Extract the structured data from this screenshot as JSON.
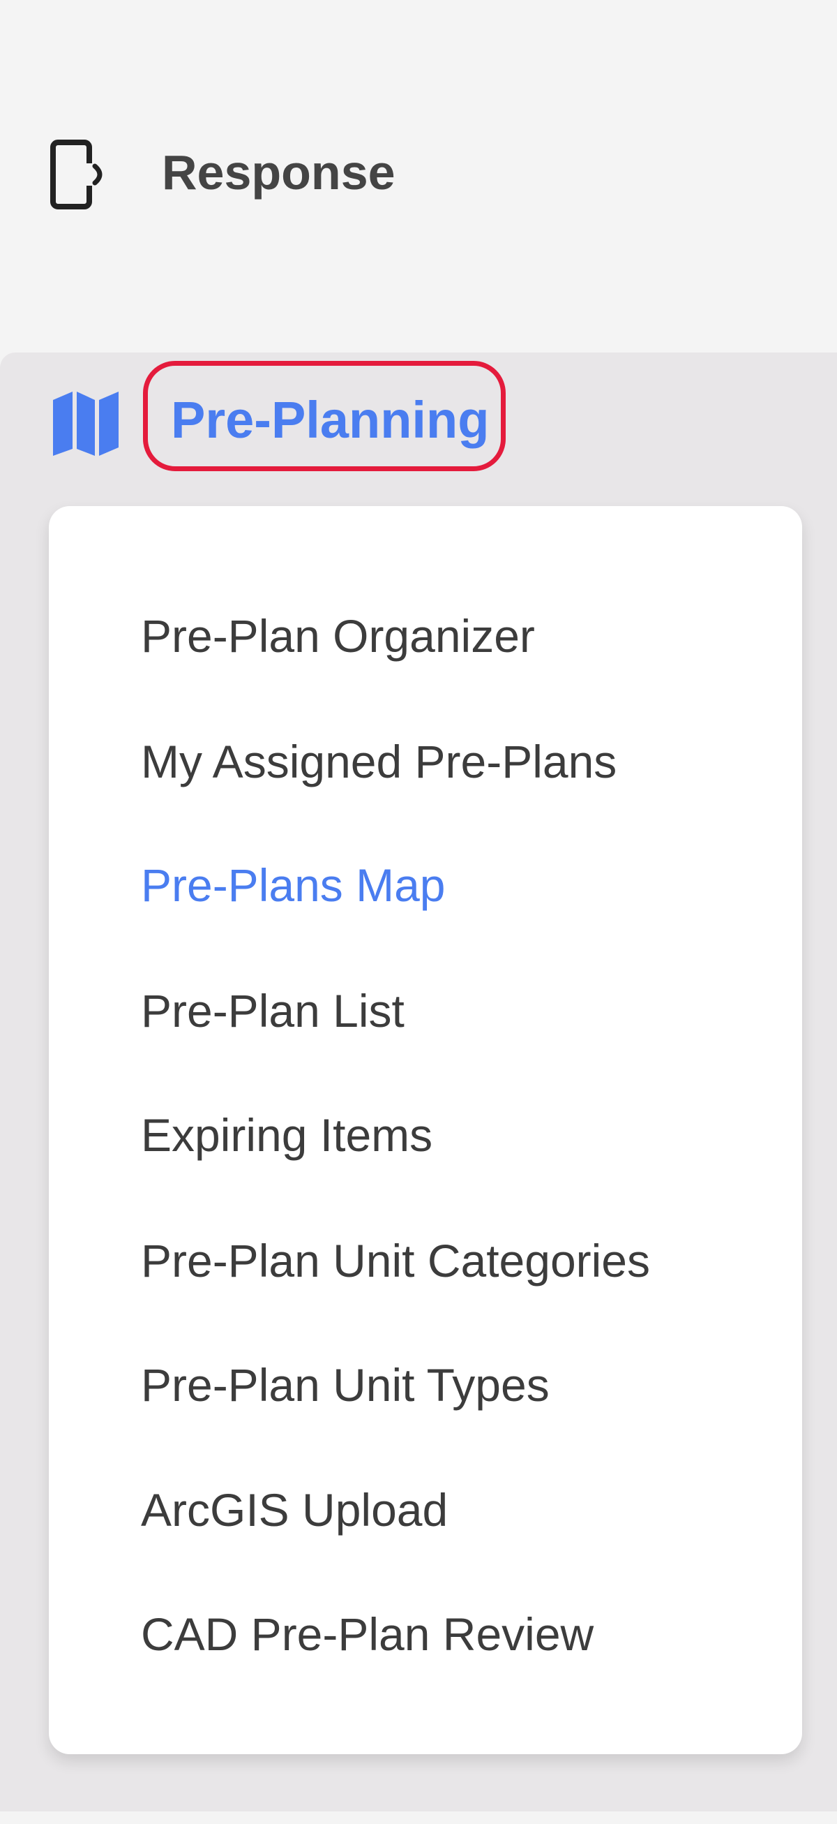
{
  "nav": {
    "response": {
      "label": "Response",
      "icon": "mobile-device-signal-icon"
    },
    "preplanning": {
      "label": "Pre-Planning",
      "icon": "map-icon",
      "accent_color": "#4a7df0",
      "highlight_color": "#e41b3c",
      "items": [
        {
          "label": "Pre-Plan Organizer",
          "active": false
        },
        {
          "label": "My Assigned Pre-Plans",
          "active": false
        },
        {
          "label": "Pre-Plans Map",
          "active": true
        },
        {
          "label": "Pre-Plan List",
          "active": false
        },
        {
          "label": "Expiring Items",
          "active": false
        },
        {
          "label": "Pre-Plan Unit Categories",
          "active": false
        },
        {
          "label": "Pre-Plan Unit Types",
          "active": false
        },
        {
          "label": "ArcGIS Upload",
          "active": false
        },
        {
          "label": "CAD Pre-Plan Review",
          "active": false
        }
      ]
    }
  }
}
